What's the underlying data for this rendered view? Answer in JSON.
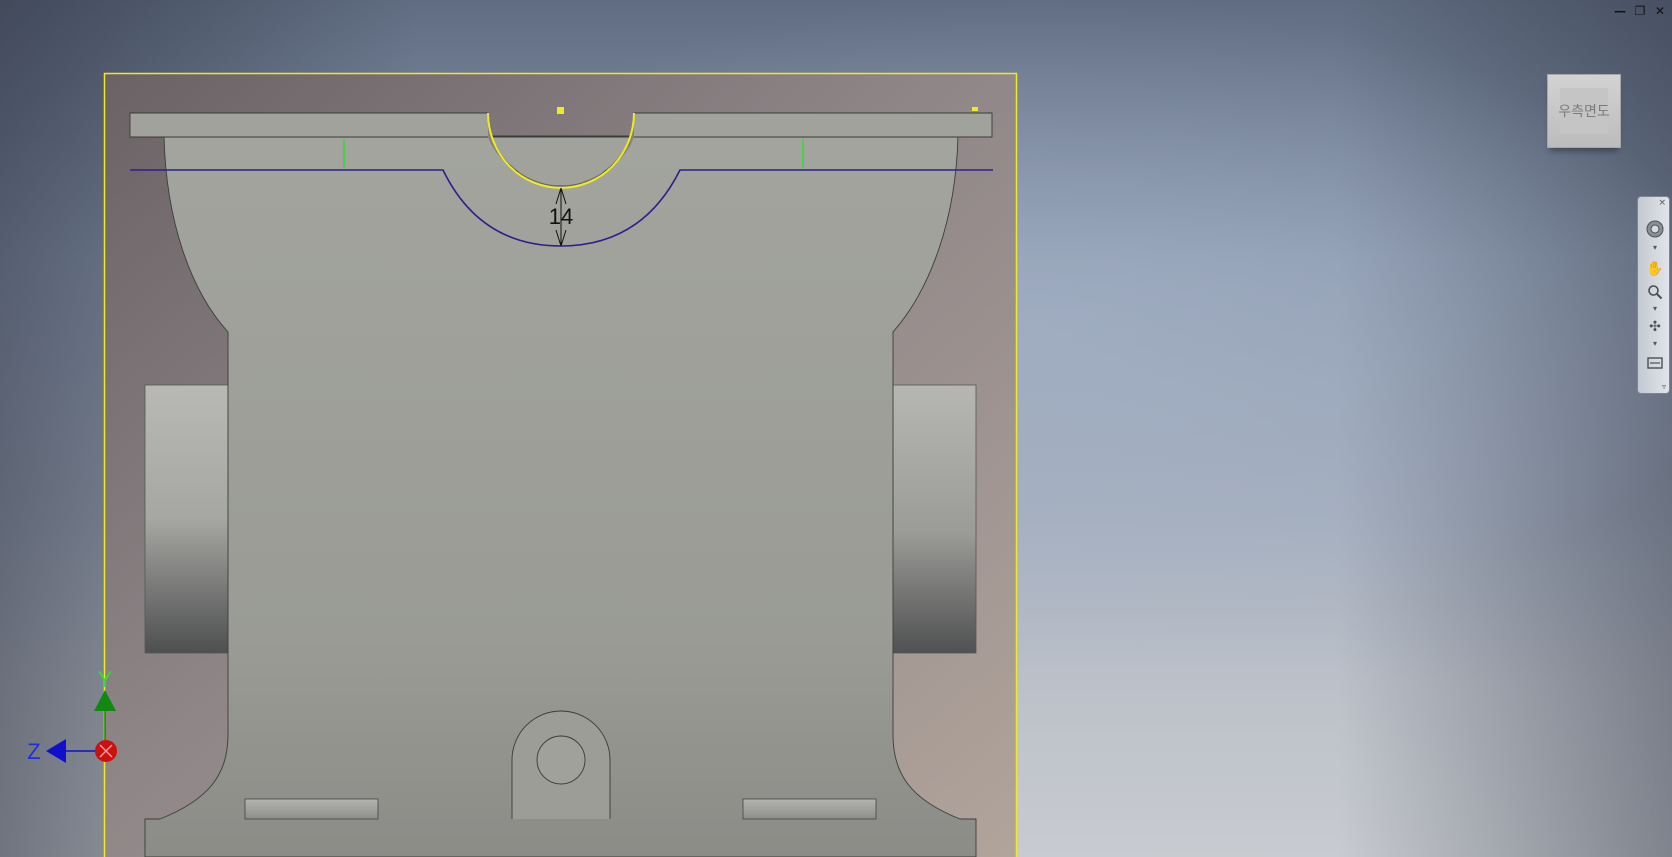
{
  "window_controls": {
    "minimize": "—",
    "restore": "❐",
    "close": "✕"
  },
  "viewcube": {
    "face_label": "우측면도"
  },
  "dimension": {
    "value": "14"
  },
  "triad": {
    "y_label": "Y",
    "z_label": "Z"
  },
  "navbar": {
    "close": "×",
    "tools": [
      "steering-wheel",
      "pan",
      "zoom",
      "orbit",
      "look-at"
    ]
  },
  "colors": {
    "sketch_boundary": "#f0ea20",
    "profile_line": "#2e1f8c",
    "constraint_tick": "#33dd33",
    "part_face": "#9d9e98",
    "x_axis": "#cc1010",
    "y_axis": "#118811",
    "z_axis": "#1010cc"
  }
}
